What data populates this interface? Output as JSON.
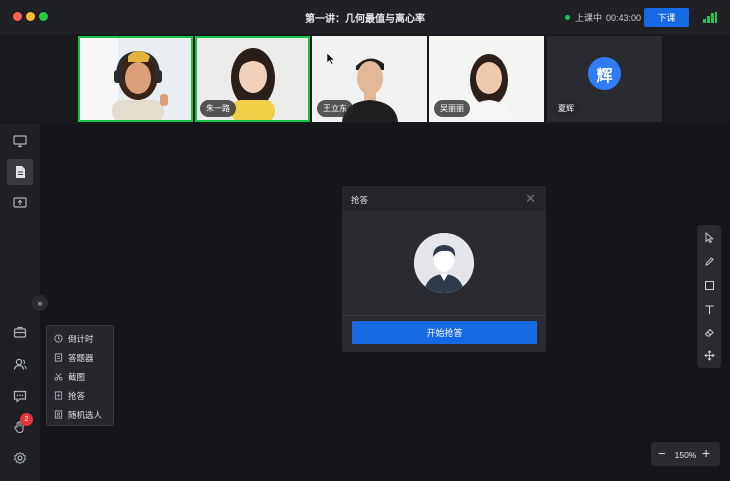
{
  "window": {
    "title": "第一讲：几何最值与离心率",
    "status_label": "上课中",
    "elapsed_time": "00:43:00",
    "end_class_label": "下课"
  },
  "participants": [
    {
      "name": "",
      "active": true
    },
    {
      "name": "朱一路",
      "active": true
    },
    {
      "name": "王立东",
      "active": false
    },
    {
      "name": "吴丽丽",
      "active": false
    },
    {
      "name": "夏辉",
      "active": false,
      "avatar_char": "辉"
    }
  ],
  "tools_menu": {
    "items": [
      {
        "label": "倒计时",
        "icon": "clock-icon"
      },
      {
        "label": "答题器",
        "icon": "answer-card-icon"
      },
      {
        "label": "截图",
        "icon": "scissors-icon"
      },
      {
        "label": "抢答",
        "icon": "buzzer-icon"
      },
      {
        "label": "随机选人",
        "icon": "random-pick-icon"
      }
    ]
  },
  "sidebar": {
    "notification_count": "2"
  },
  "dialog": {
    "title": "抢答",
    "start_button_label": "开始抢答"
  },
  "zoom": {
    "value": "150%"
  },
  "colors": {
    "accent": "#1668e3",
    "active_border": "#18c24a",
    "badge": "#e5343a",
    "background": "#1c1d21"
  }
}
